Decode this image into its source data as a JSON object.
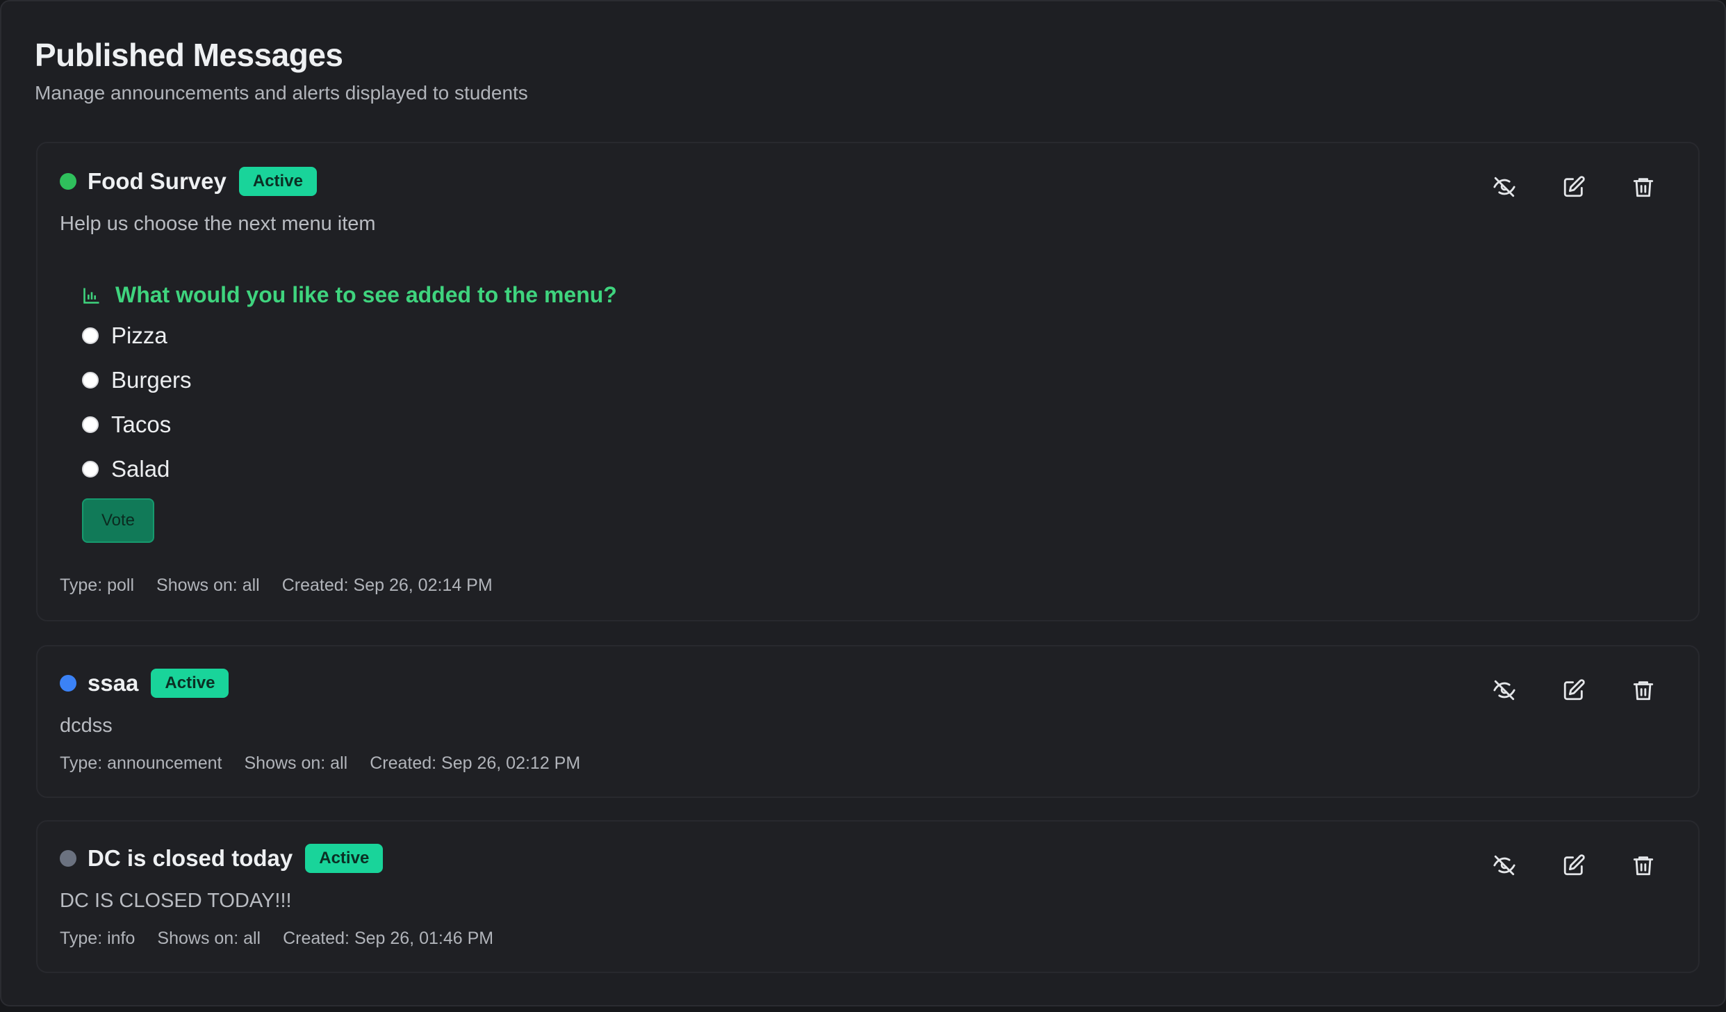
{
  "header": {
    "title": "Published Messages",
    "subtitle": "Manage announcements and alerts displayed to students"
  },
  "colors": {
    "active_badge": "#19d49a",
    "dot_green": "#2fc05c",
    "dot_blue": "#3b82f6",
    "dot_gray": "#6b7280",
    "poll_accent": "#3fd47e"
  },
  "messages": [
    {
      "title": "Food Survey",
      "status": "Active",
      "description": "Help us choose the next menu item",
      "poll": {
        "question": "What would you like to see added to the menu?",
        "options": [
          "Pizza",
          "Burgers",
          "Tacos",
          "Salad"
        ],
        "vote_label": "Vote"
      },
      "meta": {
        "type": "Type: poll",
        "shows_on": "Shows on: all",
        "created": "Created: Sep 26, 02:14 PM"
      }
    },
    {
      "title": "ssaa",
      "status": "Active",
      "description": "dcdss",
      "meta": {
        "type": "Type: announcement",
        "shows_on": "Shows on: all",
        "created": "Created: Sep 26, 02:12 PM"
      }
    },
    {
      "title": "DC is closed today",
      "status": "Active",
      "description": "DC IS CLOSED TODAY!!!",
      "meta": {
        "type": "Type: info",
        "shows_on": "Shows on: all",
        "created": "Created: Sep 26, 01:46 PM"
      }
    }
  ],
  "icons": {
    "hide": "eye-off-icon",
    "edit": "edit-icon",
    "delete": "trash-icon",
    "poll": "bar-chart-icon"
  }
}
